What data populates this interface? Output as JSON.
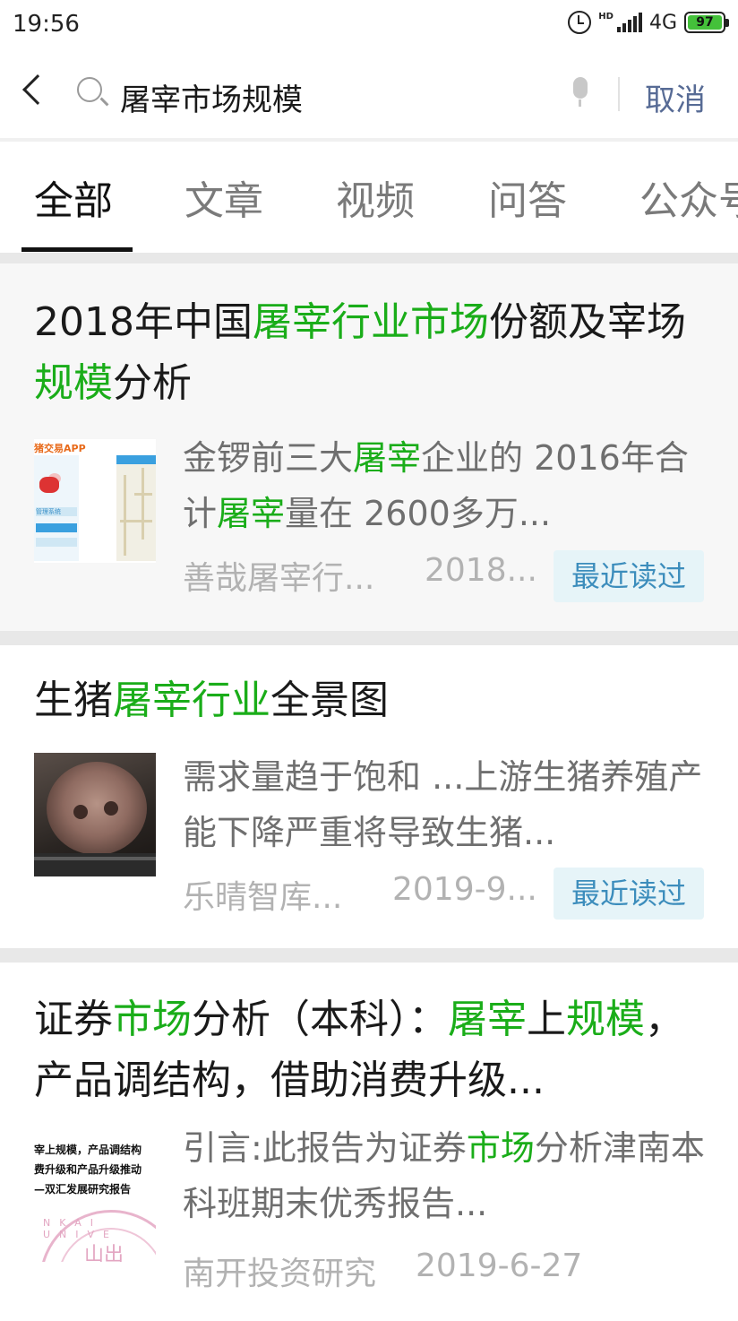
{
  "status_bar": {
    "time": "19:56",
    "hd": "HD",
    "network": "4G",
    "battery": "97"
  },
  "search": {
    "query": "屠宰市场规模",
    "cancel_label": "取消"
  },
  "tabs": [
    "全部",
    "文章",
    "视频",
    "问答",
    "公众号"
  ],
  "results": [
    {
      "title_parts": [
        {
          "text": "2018年中国",
          "highlight": false
        },
        {
          "text": "屠宰行业市场",
          "highlight": true
        },
        {
          "text": "份额及宰场",
          "highlight": false
        },
        {
          "text": "规模",
          "highlight": true
        },
        {
          "text": "分析",
          "highlight": false
        }
      ],
      "snippet_parts": [
        {
          "text": "金锣前三大",
          "highlight": false
        },
        {
          "text": "屠宰",
          "highlight": true
        },
        {
          "text": "企业的 2016年合计",
          "highlight": false
        },
        {
          "text": "屠宰",
          "highlight": true
        },
        {
          "text": "量在 2600多万...",
          "highlight": false
        }
      ],
      "source": "善哉屠宰行...",
      "date": "2018...",
      "badge": "最近读过",
      "thumb": {
        "app_name": "猪交易APP",
        "system_label": "管理系统"
      }
    },
    {
      "title_parts": [
        {
          "text": "生猪",
          "highlight": false
        },
        {
          "text": "屠宰行业",
          "highlight": true
        },
        {
          "text": "全景图",
          "highlight": false
        }
      ],
      "snippet_parts": [
        {
          "text": "需求量趋于饱和 ...上游生猪养殖产能下降严重将导致生猪...",
          "highlight": false
        }
      ],
      "source": "乐晴智库...",
      "date": "2019-9...",
      "badge": "最近读过"
    },
    {
      "title_parts": [
        {
          "text": "证券",
          "highlight": false
        },
        {
          "text": "市场",
          "highlight": true
        },
        {
          "text": "分析（本科）：",
          "highlight": false
        },
        {
          "text": "屠宰",
          "highlight": true
        },
        {
          "text": "上",
          "highlight": false
        },
        {
          "text": "规模",
          "highlight": true
        },
        {
          "text": "，产品调结构，借助消费升级...",
          "highlight": false
        }
      ],
      "snippet_parts": [
        {
          "text": "引言:此报告为证券",
          "highlight": false
        },
        {
          "text": "市场",
          "highlight": true
        },
        {
          "text": "分析津南本科班期末优秀报告...",
          "highlight": false
        }
      ],
      "source": "南开投资研究",
      "date": "2019-6-27",
      "thumb": {
        "lines": [
          "宰上规模，产品调结构",
          "费升级和产品升级推动",
          "—双汇发展研究报告"
        ],
        "seal_text": "NKAI UNIVE",
        "seal_glyph": "山出"
      }
    }
  ],
  "colors": {
    "highlight": "#1aad19",
    "cancel": "#576b95",
    "badge_text": "#3c8dbc",
    "badge_bg": "#e6f4f8"
  }
}
